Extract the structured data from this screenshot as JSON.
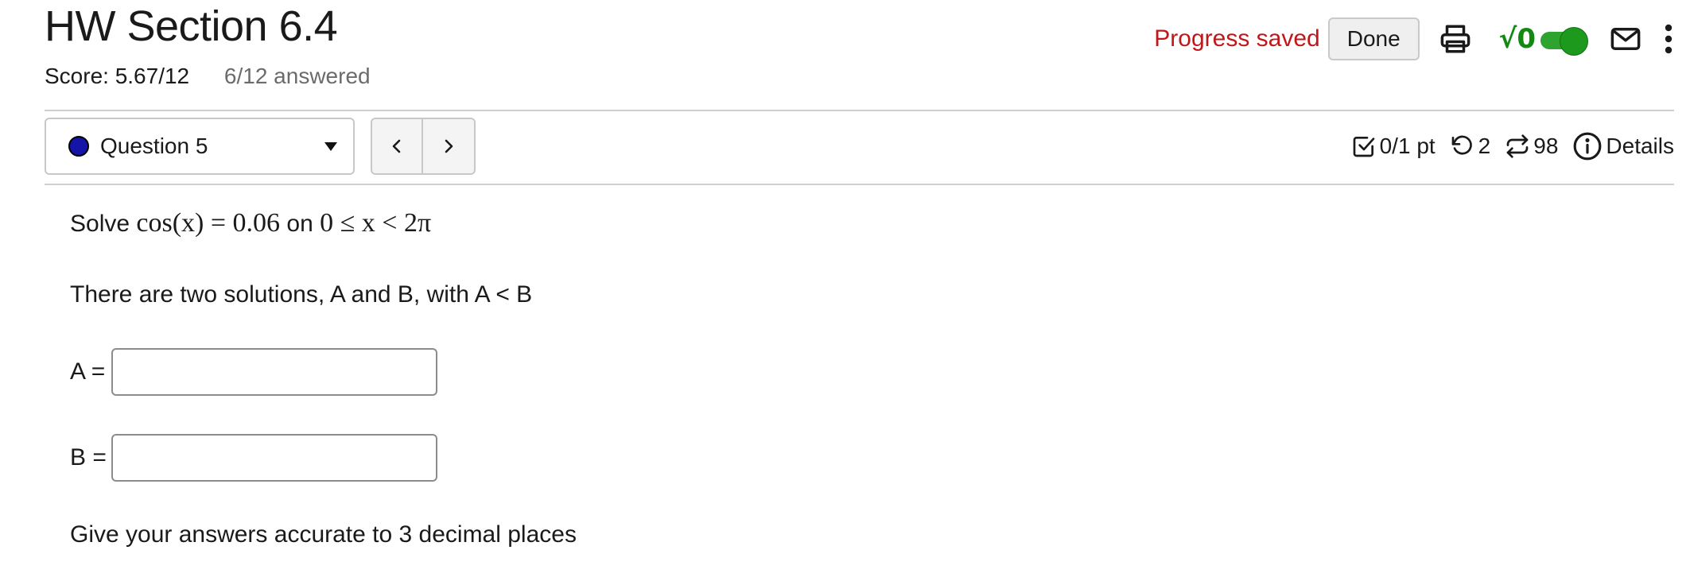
{
  "assignment": {
    "title": "HW Section 6.4",
    "score": "Score: 5.67/12",
    "answered": "6/12 answered"
  },
  "toolbar": {
    "progress_status": "Progress saved",
    "done_label": "Done",
    "sqrt_label": "√0",
    "math_toggle_on": true,
    "icons": [
      "printer-icon",
      "sqrt-toggle",
      "mail-icon",
      "kebab-menu-icon"
    ],
    "accent_green": "#1d9a1d",
    "status_red": "#c0181a"
  },
  "question_nav": {
    "selected": "Question 5",
    "status_dot_color": "#1414a8",
    "prev_icon": "chevron-left-icon",
    "next_icon": "chevron-right-icon"
  },
  "question_meta": {
    "points": "0/1 pt",
    "retries": "2",
    "attempts": "98",
    "details_label": "Details"
  },
  "question": {
    "prompt_word": "Solve",
    "equation_lhs": "cos(x) = 0.06",
    "on_word": "on",
    "interval": "0 ≤ x < 2π",
    "intro": "There are two solutions, A and B, with A < B",
    "field_a_label": "A =",
    "field_a_value": "",
    "field_b_label": "B =",
    "field_b_value": "",
    "instructions": "Give your answers accurate to 3 decimal places"
  }
}
